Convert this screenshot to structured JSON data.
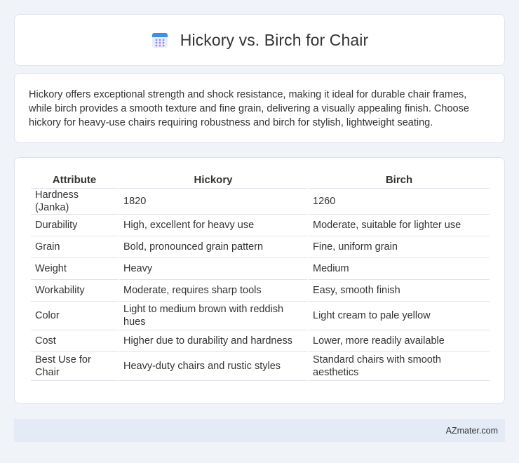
{
  "header": {
    "title": "Hickory vs. Birch for Chair",
    "icon": "calendar-icon",
    "icon_colors": {
      "top": "#3d8ef0",
      "body": "#e6eefc",
      "dots": "#a48ae0"
    }
  },
  "summary": {
    "text": "Hickory offers exceptional strength and shock resistance, making it ideal for durable chair frames, while birch provides a smooth texture and fine grain, delivering a visually appealing finish. Choose hickory for heavy-use chairs requiring robustness and birch for stylish, lightweight seating."
  },
  "table": {
    "headers": [
      "Attribute",
      "Hickory",
      "Birch"
    ],
    "rows": [
      [
        "Hardness (Janka)",
        "1820",
        "1260"
      ],
      [
        "Durability",
        "High, excellent for heavy use",
        "Moderate, suitable for lighter use"
      ],
      [
        "Grain",
        "Bold, pronounced grain pattern",
        "Fine, uniform grain"
      ],
      [
        "Weight",
        "Heavy",
        "Medium"
      ],
      [
        "Workability",
        "Moderate, requires sharp tools",
        "Easy, smooth finish"
      ],
      [
        "Color",
        "Light to medium brown with reddish hues",
        "Light cream to pale yellow"
      ],
      [
        "Cost",
        "Higher due to durability and hardness",
        "Lower, more readily available"
      ],
      [
        "Best Use for Chair",
        "Heavy-duty chairs and rustic styles",
        "Standard chairs with smooth aesthetics"
      ]
    ]
  },
  "footer": {
    "text": "AZmater.com"
  },
  "colors": {
    "page_background": "#f0f3f8",
    "card_background": "#ffffff",
    "footer_background": "#e4ebf6",
    "text": "#333333"
  }
}
